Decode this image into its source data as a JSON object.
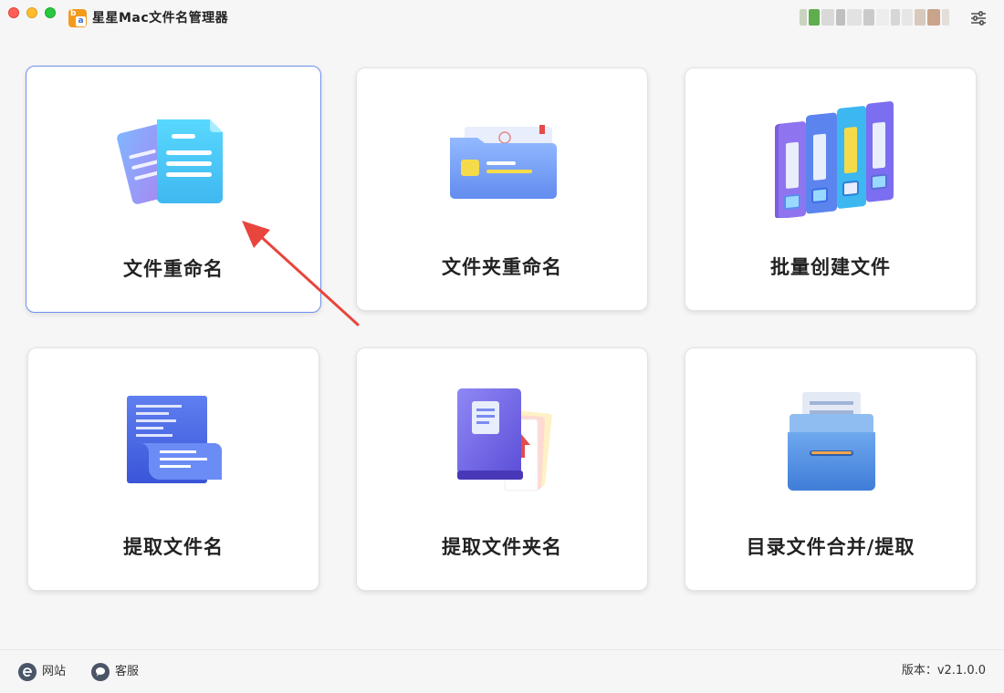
{
  "window": {
    "title": "星星Mac文件名管理器",
    "logo_text": "a"
  },
  "cards": [
    {
      "id": "file-rename",
      "label": "文件重命名",
      "icon": "file-documents-icon",
      "active": true
    },
    {
      "id": "folder-rename",
      "label": "文件夹重命名",
      "icon": "folder-icon",
      "active": false
    },
    {
      "id": "batch-create",
      "label": "批量创建文件",
      "icon": "binders-icon",
      "active": false
    },
    {
      "id": "extract-filename",
      "label": "提取文件名",
      "icon": "scroll-icon",
      "active": false
    },
    {
      "id": "extract-foldername",
      "label": "提取文件夹名",
      "icon": "book-folder-icon",
      "active": false
    },
    {
      "id": "dir-merge-extract",
      "label": "目录文件合并/提取",
      "icon": "file-cabinet-icon",
      "active": false
    }
  ],
  "footer": {
    "website_label": "网站",
    "support_label": "客服",
    "version_text": "版本：v2.1.0.0"
  },
  "colors": {
    "accent": "#6f8ff0",
    "arrow": "#e8453c",
    "background": "#f6f6f6"
  }
}
